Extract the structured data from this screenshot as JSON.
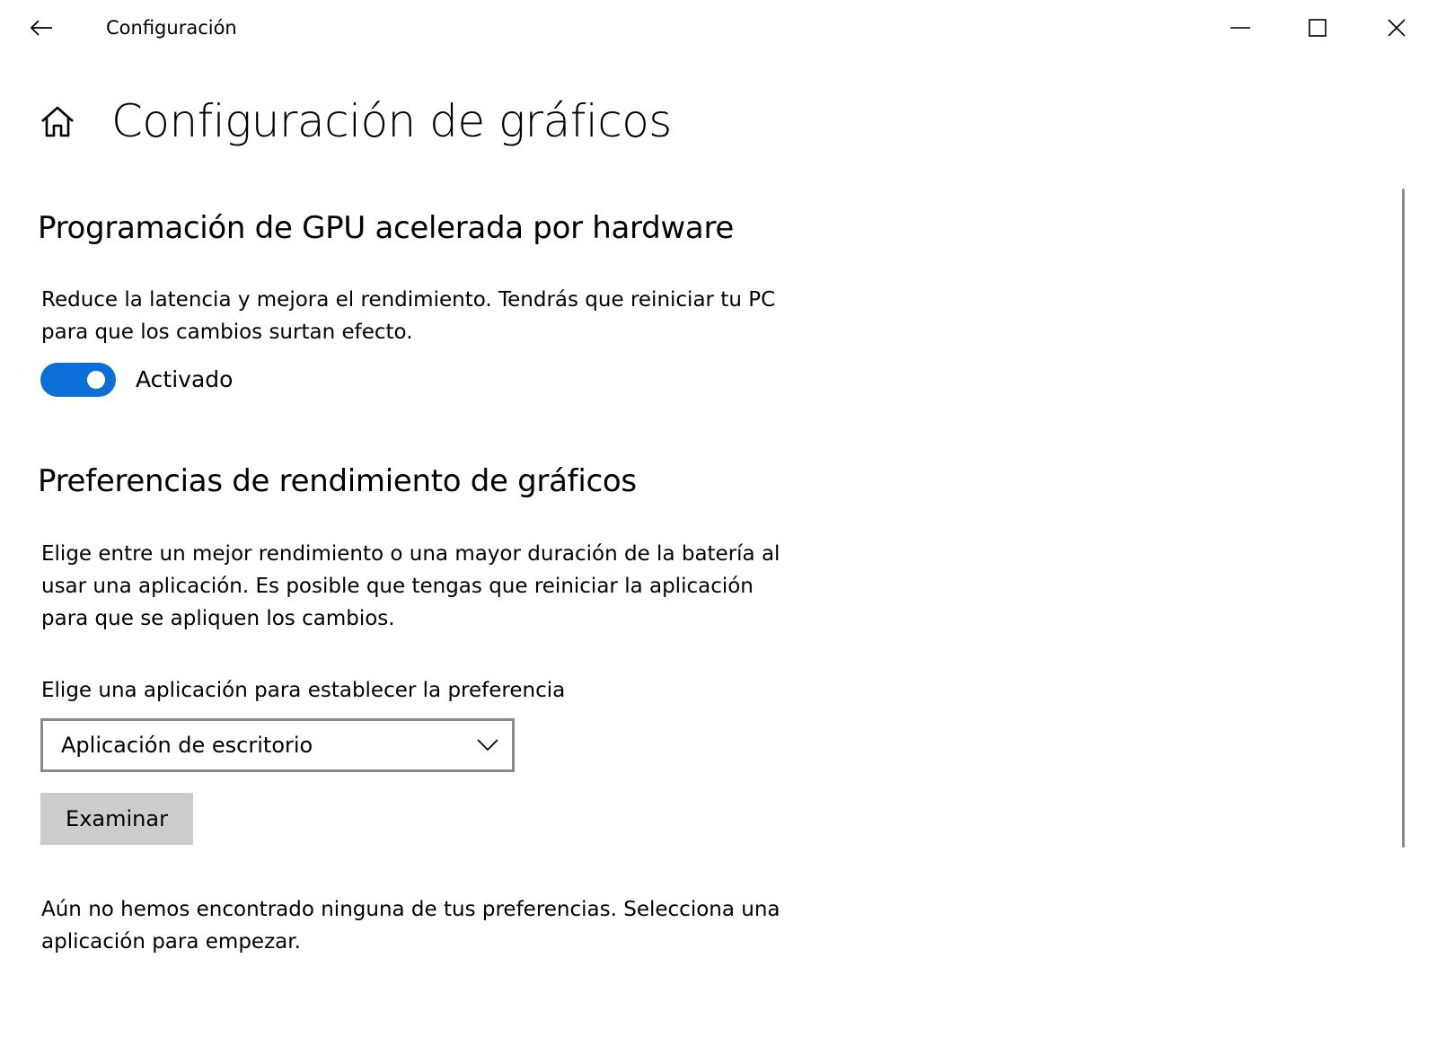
{
  "titlebar": {
    "title": "Configuración",
    "back_icon": "arrow-left-icon",
    "minimize_icon": "minimize-icon",
    "maximize_icon": "maximize-icon",
    "close_icon": "close-icon"
  },
  "header": {
    "home_icon": "home-icon",
    "title": "Configuración de gráficos"
  },
  "gpu_section": {
    "heading": "Programación de GPU acelerada por hardware",
    "description": "Reduce la latencia y mejora el rendimiento. Tendrás que reiniciar tu PC para que los cambios surtan efecto.",
    "toggle_state": true,
    "toggle_label": "Activado"
  },
  "preferences_section": {
    "heading": "Preferencias de rendimiento de gráficos",
    "description": "Elige entre un mejor rendimiento o una mayor duración de la batería al usar una aplicación. Es posible que tengas que reiniciar la aplicación para que se apliquen los cambios.",
    "select_label": "Elige una aplicación para establecer la preferencia",
    "select_value": "Aplicación de escritorio",
    "browse_label": "Examinar",
    "empty_message": "Aún no hemos encontrado ninguna de tus preferencias. Selecciona una aplicación para empezar."
  },
  "colors": {
    "accent": "#0a6fd6",
    "button_bg": "#cccccc",
    "select_border": "#8a8a8a"
  }
}
